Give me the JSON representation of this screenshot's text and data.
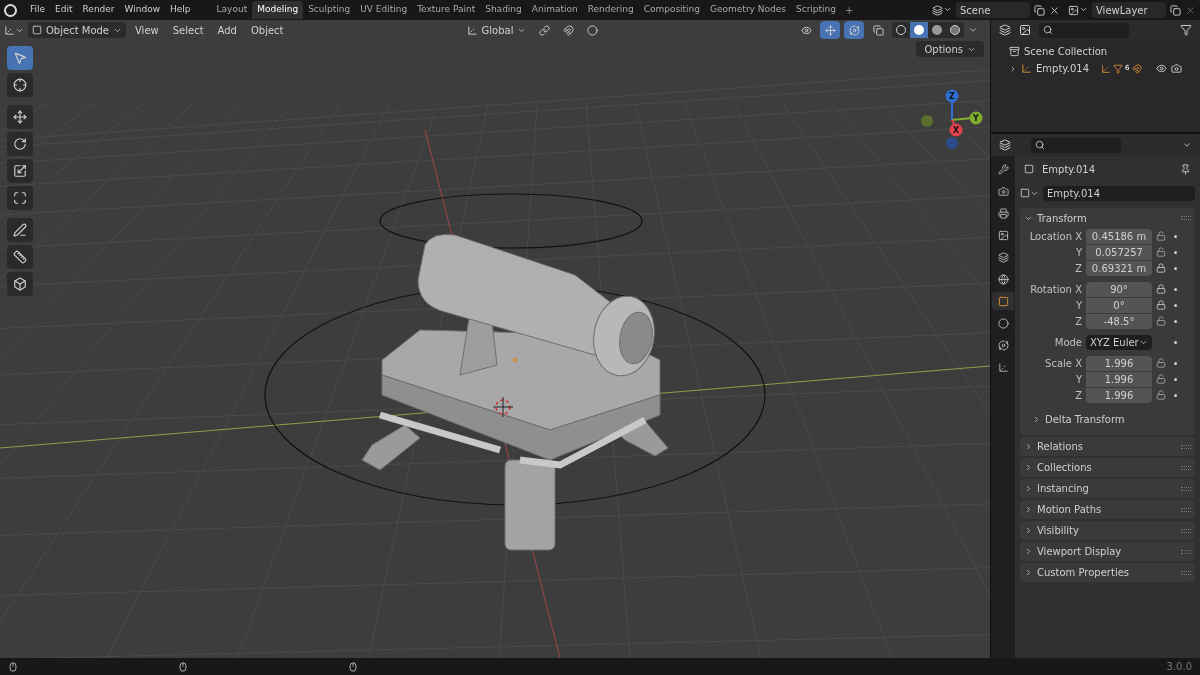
{
  "menu": [
    "File",
    "Edit",
    "Render",
    "Window",
    "Help"
  ],
  "workspaces": [
    {
      "label": "Layout",
      "selected": false
    },
    {
      "label": "Modeling",
      "selected": true
    },
    {
      "label": "Sculpting",
      "selected": false
    },
    {
      "label": "UV Editing",
      "selected": false
    },
    {
      "label": "Texture Paint",
      "selected": false
    },
    {
      "label": "Shading",
      "selected": false
    },
    {
      "label": "Animation",
      "selected": false
    },
    {
      "label": "Rendering",
      "selected": false
    },
    {
      "label": "Compositing",
      "selected": false
    },
    {
      "label": "Geometry Nodes",
      "selected": false
    },
    {
      "label": "Scripting",
      "selected": false
    }
  ],
  "workspace_overflow": "+",
  "scene": "Scene",
  "view_layer": "ViewLayer",
  "viewport_header": {
    "mode": "Object Mode",
    "menus": [
      "View",
      "Select",
      "Add",
      "Object"
    ],
    "orientation": "Global",
    "shading": [
      {
        "selected": false
      },
      {
        "selected": true
      },
      {
        "selected": false
      },
      {
        "selected": false
      }
    ]
  },
  "options_button": "Options",
  "gizmo": [
    {
      "label": "Z",
      "color": "#2f6fd6"
    },
    {
      "label": "Y",
      "color": "#7fae2e"
    },
    {
      "label": "X",
      "color": "#e0434f"
    }
  ],
  "tools": [
    {
      "kind": "select",
      "selected": true
    },
    {
      "kind": "cursor",
      "selected": false
    },
    {
      "kind": "move",
      "selected": false
    },
    {
      "kind": "rotate",
      "selected": false
    },
    {
      "kind": "scale",
      "selected": false
    },
    {
      "kind": "transform",
      "selected": false
    },
    {
      "kind": "annotate",
      "selected": false
    },
    {
      "kind": "measure",
      "selected": false
    },
    {
      "kind": "add_cube",
      "selected": false
    }
  ],
  "outliner": {
    "collection": "Scene Collection",
    "items": [
      {
        "label": "Empty.014",
        "expanded": false,
        "badge": "6"
      }
    ]
  },
  "properties": {
    "tabs": [
      {
        "kind": "tool",
        "selected": false
      },
      {
        "kind": "render",
        "selected": false
      },
      {
        "kind": "output",
        "selected": false
      },
      {
        "kind": "view_layer",
        "selected": false
      },
      {
        "kind": "scene",
        "selected": false
      },
      {
        "kind": "world",
        "selected": false
      },
      {
        "kind": "object",
        "selected": true
      },
      {
        "kind": "modifiers",
        "selected": false
      },
      {
        "kind": "physics",
        "selected": false
      },
      {
        "kind": "constraints",
        "selected": false
      }
    ],
    "object_title": "Empty.014",
    "name_field": "Empty.014",
    "transform": {
      "title": "Transform",
      "expanded": true,
      "groups": [
        {
          "rows": [
            {
              "label": "Location X",
              "value": "0.45186 m",
              "locked": false
            },
            {
              "label": "Y",
              "value": "0.057257",
              "locked": false
            },
            {
              "label": "Z",
              "value": "0.69321 m",
              "locked": true
            }
          ]
        },
        {
          "rows": [
            {
              "label": "Rotation X",
              "value": "90°",
              "locked": true
            },
            {
              "label": "Y",
              "value": "0°",
              "locked": true
            },
            {
              "label": "Z",
              "value": "-48.5°",
              "locked": false
            }
          ]
        },
        {
          "mode_label": "Mode",
          "mode_value": "XYZ Euler"
        },
        {
          "rows": [
            {
              "label": "Scale X",
              "value": "1.996",
              "locked": false
            },
            {
              "label": "Y",
              "value": "1.996",
              "locked": false
            },
            {
              "label": "Z",
              "value": "1.996",
              "locked": false
            }
          ]
        }
      ],
      "subpanel": "Delta Transform"
    },
    "panels": [
      "Relations",
      "Collections",
      "Instancing",
      "Motion Paths",
      "Visibility",
      "Viewport Display",
      "Custom Properties"
    ]
  },
  "status": {
    "version": "3.0.0"
  }
}
